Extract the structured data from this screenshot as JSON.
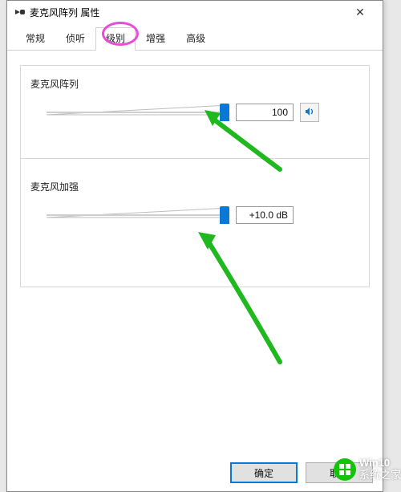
{
  "window": {
    "title": "麦克风阵列 属性",
    "close_label": "✕"
  },
  "tabs": [
    {
      "label": "常规"
    },
    {
      "label": "侦听"
    },
    {
      "label": "级别",
      "active": true
    },
    {
      "label": "增强"
    },
    {
      "label": "高级"
    }
  ],
  "groups": {
    "mic_array": {
      "label": "麦克风阵列",
      "value": "100"
    },
    "mic_boost": {
      "label": "麦克风加强",
      "value": "+10.0 dB"
    }
  },
  "buttons": {
    "ok": "确定",
    "cancel": "取消"
  },
  "watermark": {
    "line1": "Win10",
    "line2": "系统之家"
  }
}
